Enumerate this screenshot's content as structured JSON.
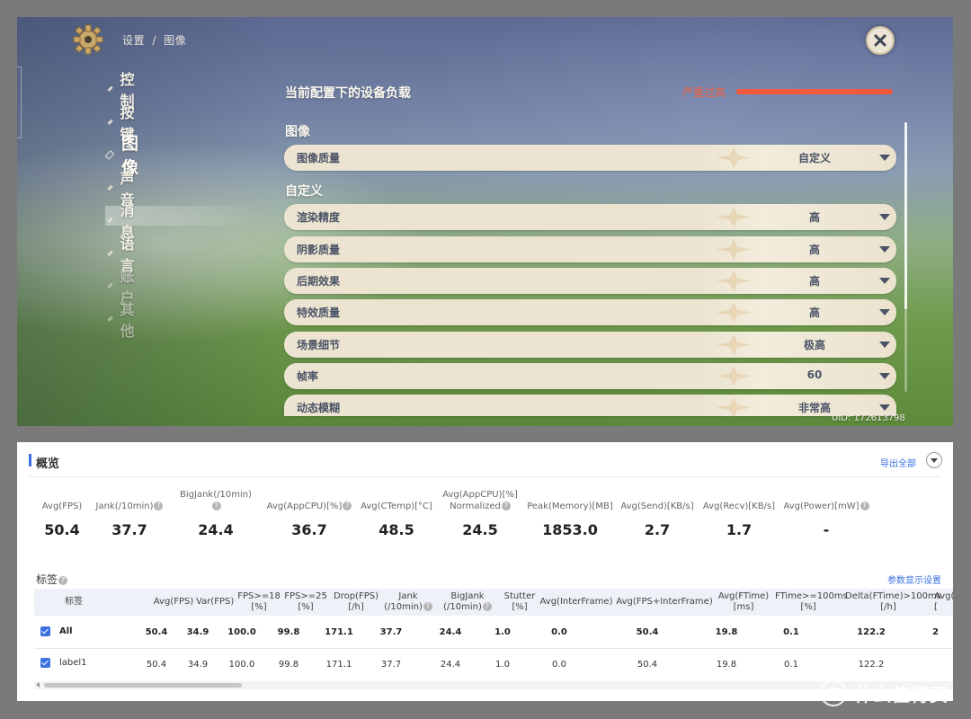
{
  "game": {
    "breadcrumb": {
      "part1": "设置",
      "sep": "/",
      "part2": "图像"
    },
    "nav": [
      "控制",
      "按键",
      "图像",
      "声音",
      "消息",
      "语言",
      "账户",
      "其他"
    ],
    "device_load_title": "当前配置下的设备负载",
    "device_load_status": "严重过高",
    "device_load_level": 1.0,
    "device_load_color": "#f05a3a",
    "section_image": "图像",
    "section_custom": "自定义",
    "quality_row": {
      "label": "图像质量",
      "value": "自定义"
    },
    "settings": [
      {
        "label": "渲染精度",
        "value": "高"
      },
      {
        "label": "阴影质量",
        "value": "高"
      },
      {
        "label": "后期效果",
        "value": "高"
      },
      {
        "label": "特效质量",
        "value": "高"
      },
      {
        "label": "场景细节",
        "value": "极高"
      },
      {
        "label": "帧率",
        "value": "60"
      },
      {
        "label": "动态模糊",
        "value": "非常高"
      }
    ],
    "uid": "UID: 172613798"
  },
  "perf": {
    "title": "概览",
    "export_all": "导出全部",
    "stats": [
      {
        "label": "Avg(FPS)",
        "value": "50.4",
        "help": false
      },
      {
        "label": "Jank(/10min)",
        "value": "37.7",
        "help": true
      },
      {
        "label": "BigJank(/10min)",
        "value": "24.4",
        "help": true
      },
      {
        "label": "Avg(AppCPU)[%]",
        "value": "36.7",
        "help": true
      },
      {
        "label": "Avg(CTemp)[°C]",
        "value": "48.5",
        "help": false
      },
      {
        "label": "Avg(AppCPU)[%] Normalized",
        "label_line1": "Avg(AppCPU)[%]",
        "label_line2": "Normalized",
        "value": "24.5",
        "help": true
      },
      {
        "label": "Peak(Memory)[MB]",
        "value": "1853.0",
        "help": false
      },
      {
        "label": "Avg(Send)[KB/s]",
        "value": "2.7",
        "help": false
      },
      {
        "label": "Avg(Recv)[KB/s]",
        "value": "1.7",
        "help": false
      },
      {
        "label": "Avg(Power)[mW]",
        "value": "-",
        "help": true
      }
    ],
    "tags_title": "标签",
    "param_settings": "参数显示设置",
    "table": {
      "columns": [
        {
          "l1": "标签",
          "l2": ""
        },
        {
          "l1": "Avg(FPS)",
          "l2": ""
        },
        {
          "l1": "Var(FPS)",
          "l2": ""
        },
        {
          "l1": "FPS>=18",
          "l2": "[%]"
        },
        {
          "l1": "FPS>=25",
          "l2": "[%]"
        },
        {
          "l1": "Drop(FPS)",
          "l2": "[/h]"
        },
        {
          "l1": "Jank",
          "l2": "(/10min)"
        },
        {
          "l1": "BigJank",
          "l2": "(/10min)"
        },
        {
          "l1": "Stutter",
          "l2": "[%]"
        },
        {
          "l1": "Avg(InterFrame)",
          "l2": ""
        },
        {
          "l1": "Avg(FPS+InterFrame)",
          "l2": ""
        },
        {
          "l1": "Avg(FTime)",
          "l2": "[ms]"
        },
        {
          "l1": "FTime>=100ms",
          "l2": "[%]"
        },
        {
          "l1": "Delta(FTime)>100ms",
          "l2": "[/h]"
        },
        {
          "l1": "Avg(",
          "l2": "["
        }
      ],
      "rows": [
        {
          "checked": true,
          "cells": [
            "All",
            "50.4",
            "34.9",
            "100.0",
            "99.8",
            "171.1",
            "37.7",
            "24.4",
            "1.0",
            "0.0",
            "50.4",
            "19.8",
            "0.1",
            "122.2",
            "2"
          ]
        },
        {
          "checked": true,
          "cells": [
            "label1",
            "50.4",
            "34.9",
            "100.0",
            "99.8",
            "171.1",
            "37.7",
            "24.4",
            "1.0",
            "0.0",
            "50.4",
            "19.8",
            "0.1",
            "122.2",
            ""
          ]
        }
      ]
    }
  },
  "watermark": {
    "logo": "值",
    "text": "什么值得买"
  }
}
